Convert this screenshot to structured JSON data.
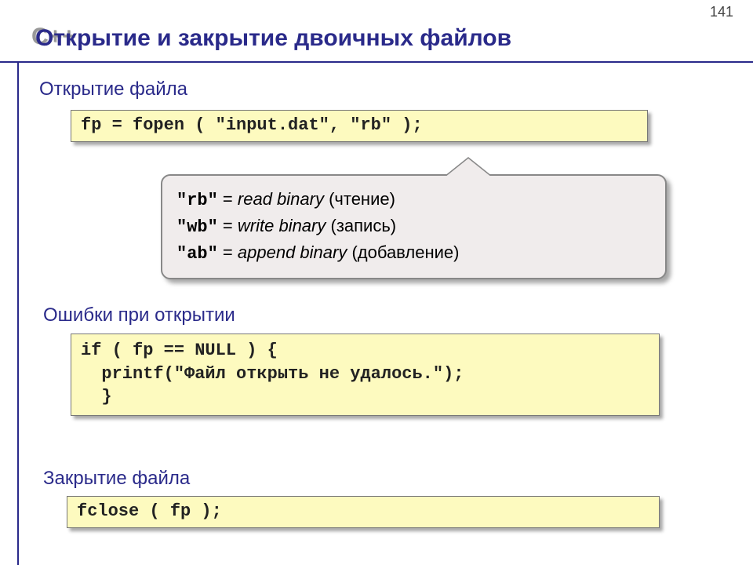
{
  "page_number": "141",
  "logo": "C++",
  "title": "Открытие и закрытие двоичных файлов",
  "sections": {
    "open": "Открытие файла",
    "errors": "Ошибки при открытии",
    "close": "Закрытие файла"
  },
  "code": {
    "fopen": "fp = fopen ( \"input.dat\", \"rb\" );",
    "if_null": "if ( fp == NULL ) {\n  printf(\"Файл открыть не удалось.\");\n  }",
    "fclose": "fclose ( fp );"
  },
  "modes": [
    {
      "code": "\"rb\"",
      "eq": " = ",
      "eng": "read binary",
      "ru": " (чтение)"
    },
    {
      "code": "\"wb\"",
      "eq": " = ",
      "eng": "write binary",
      "ru": " (запись)"
    },
    {
      "code": "\"ab\"",
      "eq": " = ",
      "eng": "append binary",
      "ru": " (добавление)"
    }
  ]
}
